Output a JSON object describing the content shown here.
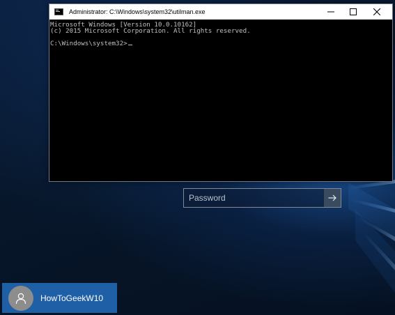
{
  "console_window": {
    "title": "Administrator: C:\\Windows\\system32\\utilman.exe",
    "icon": "console-icon",
    "lines": [
      "Microsoft Windows [Version 10.0.10162]",
      "(c) 2015 Microsoft Corporation. All rights reserved.",
      "",
      "C:\\Windows\\system32>"
    ],
    "buttons": {
      "minimize": "minimize-icon",
      "maximize": "maximize-icon",
      "close": "close-icon"
    }
  },
  "login": {
    "password_placeholder": "Password",
    "submit_icon": "arrow-right-icon"
  },
  "user": {
    "name": "HowToGeekW10",
    "avatar_icon": "user-silhouette-icon"
  },
  "colors": {
    "desktop": "#0a1a33",
    "console_bg": "#000000",
    "console_text": "#c0c0c0",
    "user_tile": "#1f5fa6",
    "submit_button": "#3a4a5f"
  }
}
